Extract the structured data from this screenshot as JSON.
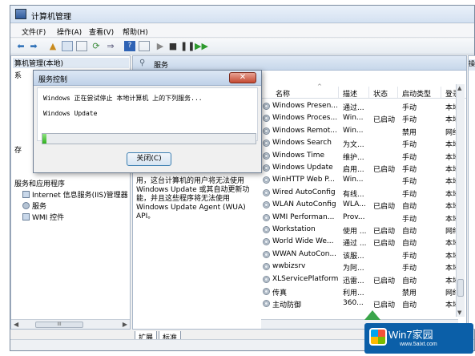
{
  "window": {
    "title": "计算机管理"
  },
  "menu": [
    "文件(F)",
    "操作(A)",
    "查看(V)",
    "帮助(H)"
  ],
  "left_tree": {
    "header": "算机管理(本地)",
    "top_partial": "系",
    "items": [
      "服务和应用程序",
      "Internet 信息服务(IIS)管理器",
      "服务",
      "WMI 控件"
    ],
    "partial_mid": "存"
  },
  "services_panel": {
    "title": "服务",
    "description": "用，这台计算机的用户将无法使用 Windows Update 或其自动更新功能，并且这些程序将无法使用 Windows Update Agent (WUA) API。",
    "columns": [
      "名称",
      "描述",
      "状态",
      "启动类型",
      "登录"
    ],
    "rows": [
      [
        "Windows Presen...",
        "通过...",
        "",
        "手动",
        "本地"
      ],
      [
        "Windows Proces...",
        "Win...",
        "已启动",
        "手动",
        "本地"
      ],
      [
        "Windows Remot...",
        "Win...",
        "",
        "禁用",
        "网络"
      ],
      [
        "Windows Search",
        "为文...",
        "",
        "手动",
        "本地"
      ],
      [
        "Windows Time",
        "维护...",
        "",
        "手动",
        "本地"
      ],
      [
        "Windows Update",
        "启用...",
        "已启动",
        "手动",
        "本地"
      ],
      [
        "WinHTTP Web P...",
        "Win...",
        "",
        "手动",
        "本地"
      ],
      [
        "Wired AutoConfig",
        "有线...",
        "",
        "手动",
        "本地"
      ],
      [
        "WLAN AutoConfig",
        "WLA...",
        "已启动",
        "自动",
        "本地"
      ],
      [
        "WMI Performan...",
        "Prov...",
        "",
        "手动",
        "本地"
      ],
      [
        "Workstation",
        "使用 ...",
        "已启动",
        "自动",
        "网络"
      ],
      [
        "World Wide We...",
        "通过 ...",
        "已启动",
        "自动",
        "本地"
      ],
      [
        "WWAN AutoCon...",
        "该服...",
        "",
        "手动",
        "本地"
      ],
      [
        "wwbizsrv",
        "为阿...",
        "",
        "手动",
        "本地"
      ],
      [
        "XLServicePlatform",
        "迅雷...",
        "已启动",
        "自动",
        "本地"
      ],
      [
        "传真",
        "利用...",
        "",
        "禁用",
        "网络"
      ],
      [
        "主动防御",
        "360...",
        "已启动",
        "自动",
        "本地"
      ]
    ]
  },
  "tabs": [
    "扩展",
    "标准"
  ],
  "right_panel": {
    "header": "操"
  },
  "dialog": {
    "title": "服务控制",
    "message": "Windows 正在尝试停止 本地计算机 上的下列服务...",
    "service": "Windows Update",
    "progress": 0.02,
    "close_button": "关闭(C)"
  },
  "watermark": {
    "brand": "Win7家园",
    "site": "www.5aixt.com"
  }
}
